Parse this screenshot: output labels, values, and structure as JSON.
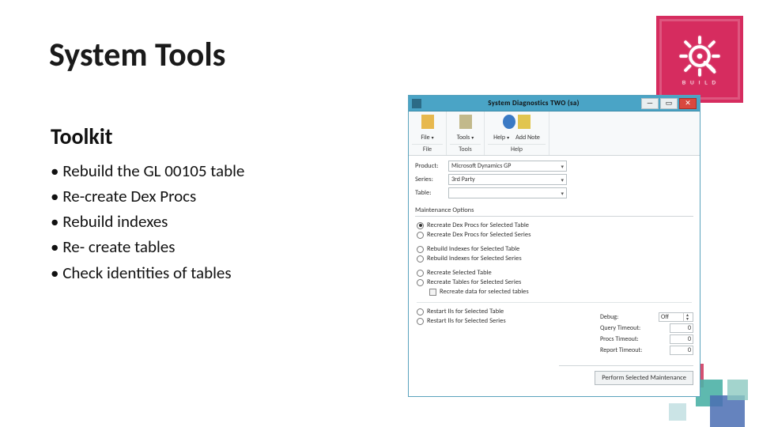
{
  "slide": {
    "title": "System Tools",
    "section": "Toolkit",
    "bullets": [
      "• Rebuild the GL 00105 table",
      "• Re-create Dex Procs",
      "• Rebuild indexes",
      "• Re- create tables",
      "• Check identities of tables"
    ]
  },
  "brand": {
    "name": "gear-icon",
    "label": "BUILD"
  },
  "window": {
    "title": "System Diagnostics   TWO (sa)",
    "controls": {
      "min": "—",
      "max": "▭",
      "close": "✕"
    },
    "ribbon": {
      "groups": [
        {
          "label": "File",
          "buttons": [
            {
              "label": "File",
              "dropdown": true
            }
          ],
          "icons": [
            "folder"
          ]
        },
        {
          "label": "Tools",
          "buttons": [
            {
              "label": "Tools",
              "dropdown": true
            }
          ],
          "icons": [
            "tools"
          ]
        },
        {
          "label": "Help",
          "buttons": [
            {
              "label": "Help",
              "dropdown": true
            },
            {
              "label": "Add Note",
              "dropdown": false
            }
          ],
          "icons": [
            "help",
            "note"
          ]
        }
      ]
    },
    "form": {
      "product": {
        "label": "Product:",
        "value": "Microsoft Dynamics GP"
      },
      "series": {
        "label": "Series:",
        "value": "3rd Party"
      },
      "table": {
        "label": "Table:",
        "value": ""
      }
    },
    "options_heading": "Maintenance Options",
    "option_blocks": [
      {
        "radios": [
          {
            "label": "Recreate Dex Procs for Selected Table",
            "checked": true
          },
          {
            "label": "Recreate Dex Procs for Selected Series",
            "checked": false
          }
        ]
      },
      {
        "radios": [
          {
            "label": "Rebuild Indexes for Selected Table",
            "checked": false
          },
          {
            "label": "Rebuild Indexes for Selected Series",
            "checked": false
          }
        ]
      },
      {
        "radios": [
          {
            "label": "Recreate Selected Table",
            "checked": false
          },
          {
            "label": "Recreate Tables for Selected Series",
            "checked": false
          }
        ],
        "checkbox": {
          "label": "Recreate data for selected tables",
          "checked": false
        }
      },
      {
        "radios": [
          {
            "label": "Restart IIs for Selected Table",
            "checked": false
          },
          {
            "label": "Restart IIs for Selected Series",
            "checked": false
          }
        ]
      }
    ],
    "timeouts": {
      "debug": {
        "label": "Debug:",
        "value": "Off",
        "spinner": true
      },
      "query": {
        "label": "Query Timeout:",
        "value": "0"
      },
      "procs": {
        "label": "Procs Timeout:",
        "value": "0"
      },
      "report": {
        "label": "Report Timeout:",
        "value": "0"
      }
    },
    "perform_label": "Perform Selected Maintenance"
  }
}
